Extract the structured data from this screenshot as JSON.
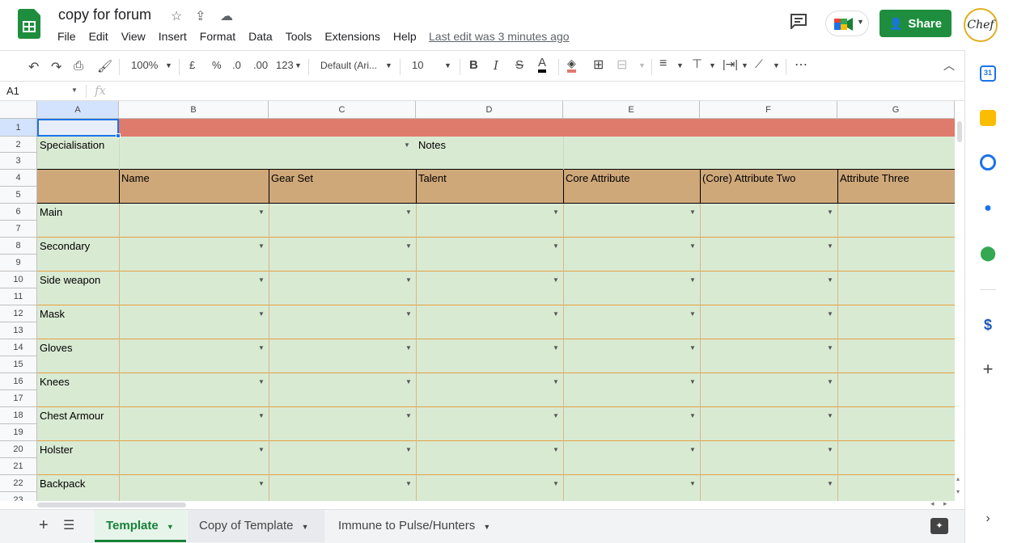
{
  "app": {
    "doc_title": "copy for forum",
    "last_edit": "Last edit was 3 minutes ago",
    "share_label": "Share",
    "avatar_text": "Chef"
  },
  "menu": [
    "File",
    "Edit",
    "View",
    "Insert",
    "Format",
    "Data",
    "Tools",
    "Extensions",
    "Help"
  ],
  "toolbar": {
    "zoom": "100%",
    "currency": "£",
    "percent": "%",
    "dec_less": ".0",
    "dec_more": ".00",
    "format_123": "123",
    "font": "Default (Ari...",
    "font_size": "10",
    "bold": "B",
    "italic": "I",
    "strike": "S",
    "text_color": "A",
    "more": "⋯"
  },
  "formula_bar": {
    "name_box": "A1",
    "fx": "fx"
  },
  "columns": [
    "A",
    "B",
    "C",
    "D",
    "E",
    "F",
    "G"
  ],
  "rows": [
    "1",
    "2",
    "3",
    "4",
    "5",
    "6",
    "7",
    "8",
    "9",
    "10",
    "11",
    "12",
    "13",
    "14",
    "15",
    "16",
    "17",
    "18",
    "19",
    "20",
    "21",
    "22",
    "23"
  ],
  "cells": {
    "specialisation": "Specialisation",
    "notes": "Notes",
    "headers": [
      "Name",
      "Gear Set",
      "Talent",
      "Core Attribute",
      "(Core) Attribute Two",
      "Attribute Three"
    ],
    "slots": [
      "Main",
      "Secondary",
      "Side weapon",
      "Mask",
      "Gloves",
      "Knees",
      "Chest Armour",
      "Holster",
      "Backpack"
    ]
  },
  "sheet_tabs": [
    {
      "label": "Template",
      "active": true
    },
    {
      "label": "Copy of Template",
      "active": false
    },
    {
      "label": "Immune to Pulse/Hunters",
      "active": false
    }
  ],
  "colors": {
    "green_cell": "#d9ead3",
    "header_cell": "#cfa87a",
    "red_row": "#df7b6c",
    "brand_green": "#1e8e3e"
  }
}
